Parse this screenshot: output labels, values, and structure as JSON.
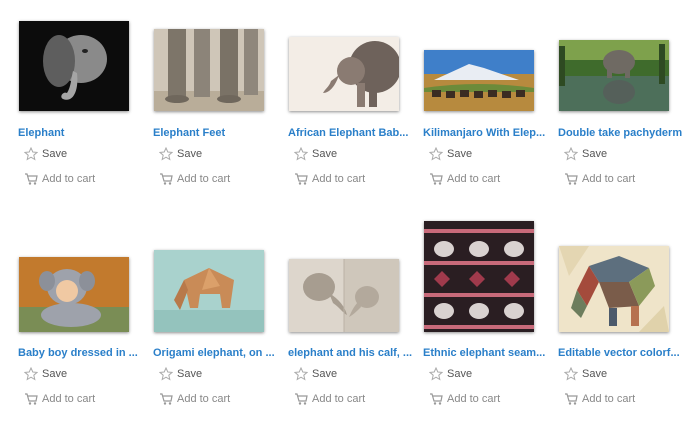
{
  "actions": {
    "save_label": "Save",
    "cart_label": "Add to cart"
  },
  "items": [
    {
      "title": "Elephant",
      "image": "black-and-white elephant portrait"
    },
    {
      "title": "Elephant Feet",
      "image": "elephant legs and feet"
    },
    {
      "title": "African Elephant Bab...",
      "image": "baby elephant with mother"
    },
    {
      "title": "Kilimanjaro With Elep...",
      "image": "elephant herd below Kilimanjaro"
    },
    {
      "title": "Double take pachyderm",
      "image": "elephant with reflection in water"
    },
    {
      "title": "Baby boy dressed in ...",
      "image": "baby in elephant costume"
    },
    {
      "title": "Origami elephant, on ...",
      "image": "paper origami elephant"
    },
    {
      "title": "elephant and his calf, ...",
      "image": "stone carving of elephant and calf"
    },
    {
      "title": "Ethnic elephant seam...",
      "image": "ethnic elephant pattern"
    },
    {
      "title": "Editable vector colorf...",
      "image": "polygonal vector elephant"
    }
  ]
}
